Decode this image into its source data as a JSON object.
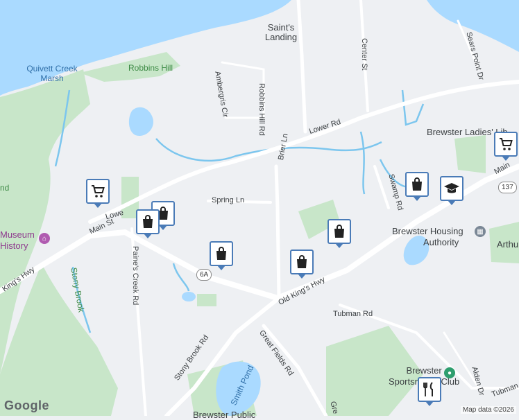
{
  "map": {
    "attribution": "Map data ©2026",
    "logo": "Google",
    "colors": {
      "water": "#aadaff",
      "park": "#c8e6c9",
      "land": "#eef0f3",
      "road": "#ffffff",
      "stream": "#7cc6ee",
      "pin_border": "#4a7bb7"
    },
    "labels": {
      "saints_landing": "Saint's Landing",
      "robbins_hill_rd": "Robbins Hill Rd",
      "center_st": "Center St",
      "sears_point_dr": "Sears Point Dr",
      "quivett_creek_marsh": "Quivett Creek Marsh",
      "robbins_hill": "Robbins Hill",
      "ambergris_cir": "Ambergris Cir",
      "lower_rd": "Lower Rd",
      "brier_ln": "Brier Ln",
      "brewster_ladies_lib": "Brewster Ladies' Lib",
      "main_st_east": "Main",
      "spring_ln": "Spring Ln",
      "swamp_rd": "Swamp Rd",
      "nd": "nd",
      "museum_line1": "Museum",
      "museum_line2": "History",
      "lower_west": "Lowe",
      "main_st": "Main St",
      "brewster_housing_line1": "Brewster Housing",
      "brewster_housing_line2": "Authority",
      "arthu": "Arthu",
      "paines_creek_rd": "Paine's Creek Rd",
      "kings_hwy_west": "King's Hwy",
      "stony_brook": "Stony Brook",
      "route_6a": "6A",
      "old_kings_hwy": "Old King's Hwy",
      "tubman_rd": "Tubman Rd",
      "stony_brook_rd": "Stony Brook Rd",
      "great_fields_rd": "Great Fields Rd",
      "brewster_sportsmans_line1": "Brewster",
      "brewster_sportsmans_line2": "Sportsman's Club",
      "alden_dr": "Alden Dr",
      "tubman_east": "Tubman",
      "smith_pond": "Smith Pond",
      "brewster_public": "Brewster Public",
      "gre": "Gre",
      "route_137": "137"
    },
    "markers": [
      {
        "icon": "cart-icon"
      },
      {
        "icon": "shopping-bag-icon"
      },
      {
        "icon": "shopping-bag-icon"
      },
      {
        "icon": "shopping-bag-icon"
      },
      {
        "icon": "shopping-bag-icon"
      },
      {
        "icon": "shopping-bag-icon"
      },
      {
        "icon": "shopping-bag-icon"
      },
      {
        "icon": "graduation-cap-icon"
      },
      {
        "icon": "cart-icon"
      },
      {
        "icon": "restaurant-icon"
      }
    ]
  }
}
